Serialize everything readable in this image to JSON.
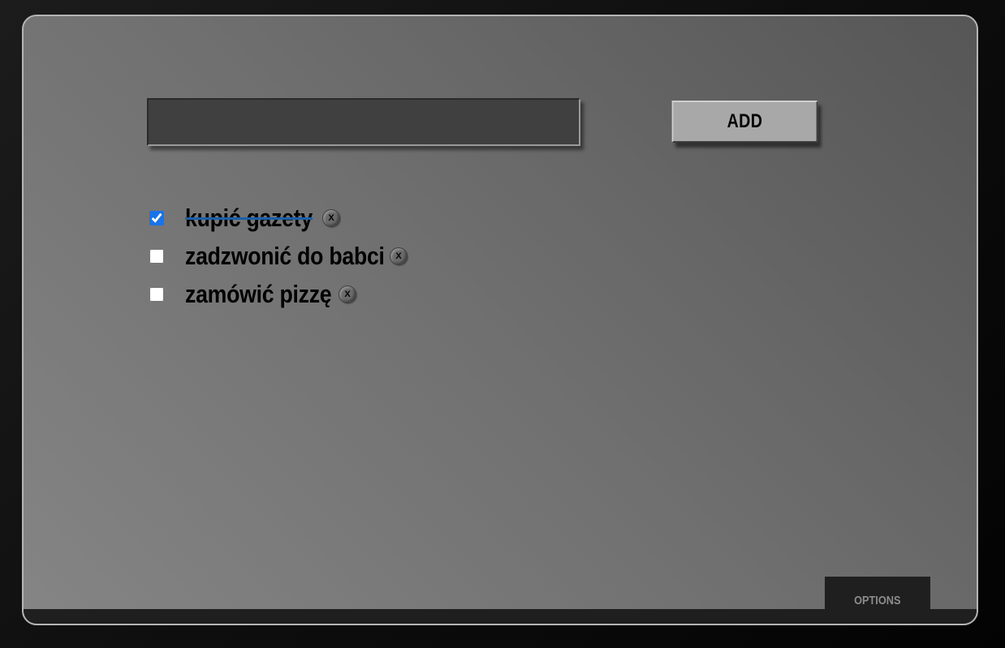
{
  "input": {
    "value": "",
    "placeholder": ""
  },
  "add_button": {
    "label": "ADD"
  },
  "todos": [
    {
      "text": "kupić gazety",
      "done": true,
      "delete_label": "X"
    },
    {
      "text": "zadzwonić do babci",
      "done": false,
      "delete_label": "X"
    },
    {
      "text": "zamówić pizzę",
      "done": false,
      "delete_label": "X"
    }
  ],
  "footer": {
    "options_label": "OPTIONS"
  },
  "colors": {
    "checkbox_accent": "#1a73e8",
    "strike_line": "#1c5fa8"
  }
}
